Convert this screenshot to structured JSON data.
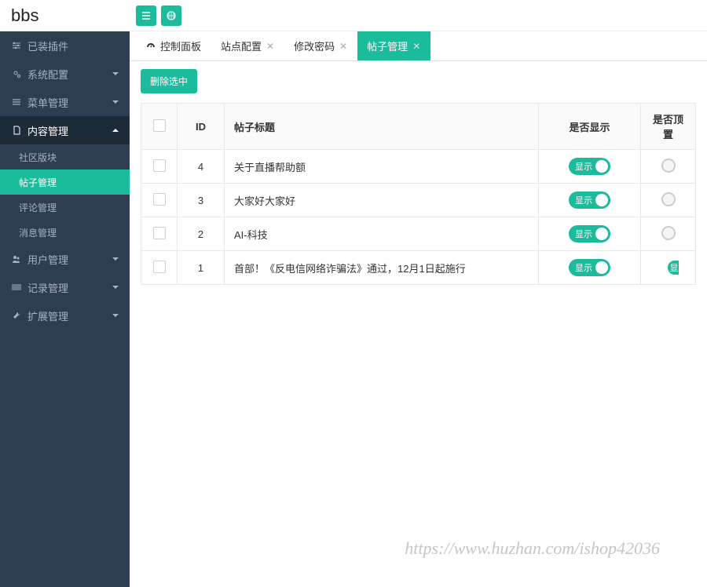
{
  "app": {
    "name": "bbs"
  },
  "sidebar": {
    "items": [
      {
        "icon": "sliders",
        "label": "已装插件",
        "expandable": false
      },
      {
        "icon": "cogs",
        "label": "系统配置",
        "expandable": true
      },
      {
        "icon": "bars",
        "label": "菜单管理",
        "expandable": true
      },
      {
        "icon": "file",
        "label": "内容管理",
        "expandable": true,
        "open": true,
        "children": [
          {
            "label": "社区版块"
          },
          {
            "label": "帖子管理",
            "active": true
          },
          {
            "label": "评论管理"
          },
          {
            "label": "消息管理"
          }
        ]
      },
      {
        "icon": "users",
        "label": "用户管理",
        "expandable": true
      },
      {
        "icon": "barcode",
        "label": "记录管理",
        "expandable": true
      },
      {
        "icon": "wrench",
        "label": "扩展管理",
        "expandable": true
      }
    ]
  },
  "tabs": [
    {
      "label": "控制面板",
      "closable": false,
      "icon": "dashboard"
    },
    {
      "label": "站点配置",
      "closable": true
    },
    {
      "label": "修改密码",
      "closable": true
    },
    {
      "label": "帖子管理",
      "closable": true,
      "active": true
    }
  ],
  "toolbar": {
    "delete_selected": "删除选中"
  },
  "table": {
    "columns": {
      "id": "ID",
      "title": "帖子标题",
      "show": "是否显示",
      "top": "是否顶置"
    },
    "toggle_label": "显示",
    "rows": [
      {
        "id": "4",
        "title": "关于直播帮助额",
        "show": true,
        "top": false
      },
      {
        "id": "3",
        "title": "大家好大家好",
        "show": true,
        "top": false
      },
      {
        "id": "2",
        "title": "AI-科技",
        "show": true,
        "top": false
      },
      {
        "id": "1",
        "title": "首部！《反电信网络诈骗法》通过，12月1日起施行",
        "show": true,
        "top": true,
        "top_label": "显"
      }
    ]
  },
  "watermark": "https://www.huzhan.com/ishop42036"
}
